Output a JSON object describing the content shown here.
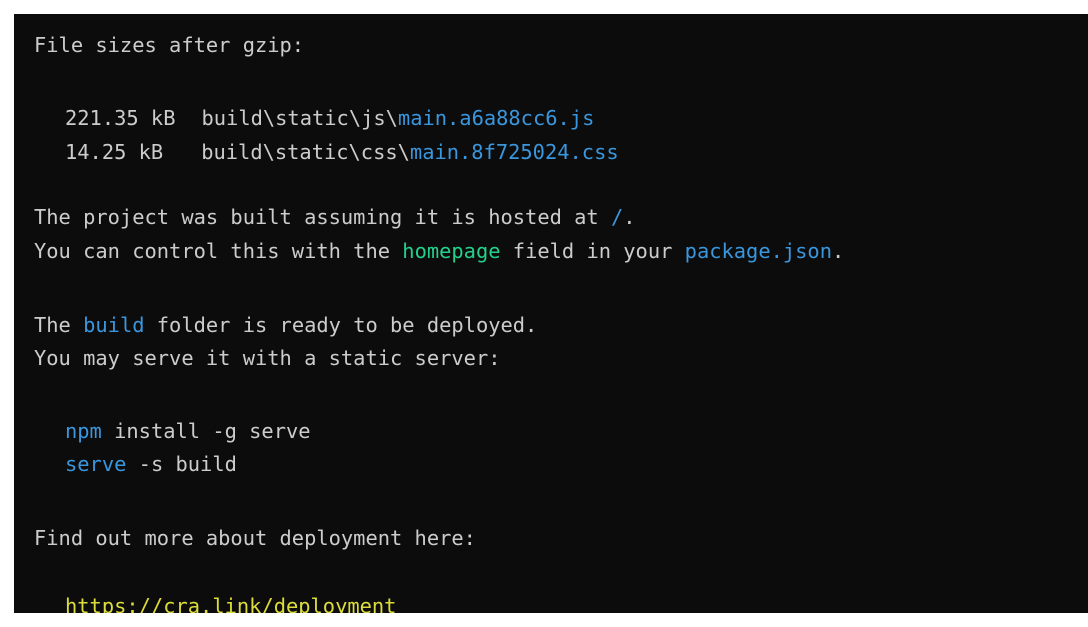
{
  "terminal": {
    "heading": "File sizes after gzip:",
    "files": [
      {
        "size": "221.35 kB",
        "dir": "build\\static\\js\\",
        "name": "main.a6a88cc6.js"
      },
      {
        "size": "14.25 kB",
        "dir": "build\\static\\css\\",
        "name": "main.8f725024.css"
      }
    ],
    "hosted_prefix": "The project was built assuming it is hosted at ",
    "hosted_path": "/",
    "hosted_suffix": ".",
    "control_prefix": "You can control this with the ",
    "control_field": "homepage",
    "control_mid": " field in your ",
    "control_file": "package.json",
    "control_suffix": ".",
    "folder_prefix": "The ",
    "folder_name": "build",
    "folder_suffix": " folder is ready to be deployed.",
    "serve_line": "You may serve it with a static server:",
    "cmd1_name": "npm",
    "cmd1_args": " install -g serve",
    "cmd2_name": "serve",
    "cmd2_args": " -s build",
    "more_line": "Find out more about deployment here:",
    "link": "https://cra.link/deployment"
  },
  "colors": {
    "background": "#0c0c0c",
    "text": "#cccccc",
    "blue": "#3a96dd",
    "green": "#23d18b",
    "yellow": "#dcdc3a"
  }
}
